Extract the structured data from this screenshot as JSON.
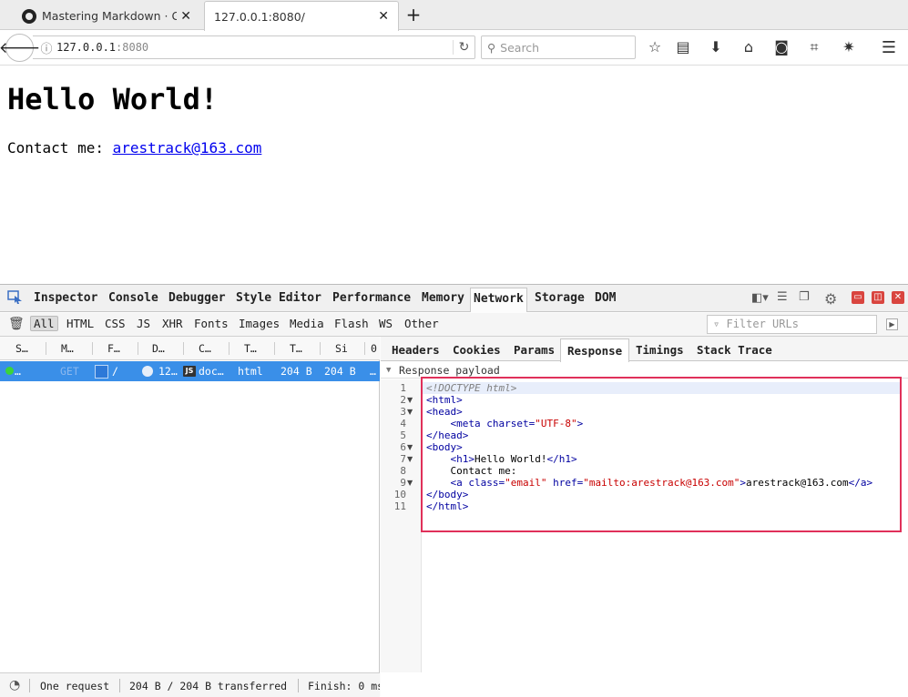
{
  "browser": {
    "tabs": [
      {
        "title": "Mastering Markdown · G",
        "close": "✕",
        "active": false
      },
      {
        "title": "127.0.0.1:8080/",
        "close": "✕",
        "active": true
      }
    ],
    "new_tab": "+",
    "url_host": "127.0.0.1",
    "url_port": ":8080",
    "search_placeholder": "Search"
  },
  "page": {
    "heading": "Hello World!",
    "contact_label": "Contact me: ",
    "contact_link": "arestrack@163.com"
  },
  "devtools": {
    "tools": [
      "Inspector",
      "Console",
      "Debugger",
      "Style Editor",
      "Performance",
      "Memory",
      "Network",
      "Storage",
      "DOM"
    ],
    "selected_tool": "Network",
    "filter_types": [
      "All",
      "HTML",
      "CSS",
      "JS",
      "XHR",
      "Fonts",
      "Images",
      "Media",
      "Flash",
      "WS",
      "Other"
    ],
    "filter_placeholder": "Filter URLs",
    "columns": [
      "S…",
      "M…",
      "F…",
      "D…",
      "C…",
      "T…",
      "T…",
      "Si",
      "0"
    ],
    "request": {
      "method": "GET",
      "file": "/",
      "domain": "12…",
      "cause": "doc…",
      "cause_badge": "JS",
      "type": "html",
      "transferred": "204 B",
      "size": "204 B",
      "timeline": "…"
    },
    "footer": {
      "count": "One request",
      "transferred": "204 B / 204 B transferred",
      "finish": "Finish: 0 ms"
    },
    "detail_tabs": [
      "Headers",
      "Cookies",
      "Params",
      "Response",
      "Timings",
      "Stack Trace"
    ],
    "selected_detail_tab": "Response",
    "payload_label": "Response payload",
    "line_numbers": [
      "1",
      "2",
      "3",
      "4",
      "5",
      "6",
      "7",
      "8",
      "9",
      "10",
      "11"
    ],
    "code": {
      "l1": "<!DOCTYPE html>",
      "l2": "<html>",
      "l3": "<head>",
      "l4_open": "<meta ",
      "l4_attr": "charset=",
      "l4_val": "\"UTF-8\"",
      "l4_close": ">",
      "l5": "</head>",
      "l6": "<body>",
      "l7_open": "<h1>",
      "l7_text": "Hello World!",
      "l7_close": "</h1>",
      "l8": "Contact me:",
      "l9_open": "<a ",
      "l9_attr1": "class=",
      "l9_val1": "\"email\"",
      "l9_attr2": " href=",
      "l9_val2": "\"mailto:arestrack@163.com\"",
      "l9_gt": ">",
      "l9_text": "arestrack@163.com",
      "l9_close": "</a>",
      "l10": "</body>",
      "l11": "</html>"
    }
  }
}
